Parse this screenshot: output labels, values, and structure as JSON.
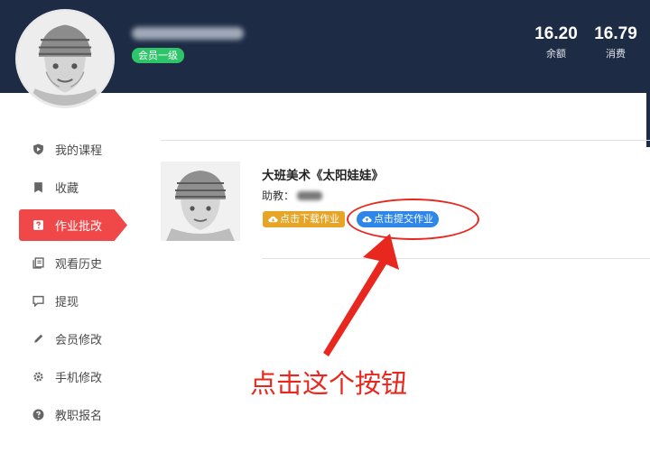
{
  "header": {
    "username": "",
    "member_badge": "会员一级",
    "stats": {
      "balance": {
        "value": "16.20",
        "label": "余额"
      },
      "spend": {
        "value": "16.79",
        "label": "消费"
      }
    }
  },
  "sidebar": {
    "items": [
      {
        "label": "我的课程",
        "icon": "shield-icon",
        "active": false
      },
      {
        "label": "收藏",
        "icon": "bookmark-icon",
        "active": false
      },
      {
        "label": "作业批改",
        "icon": "question-icon",
        "active": true
      },
      {
        "label": "观看历史",
        "icon": "history-icon",
        "active": false
      },
      {
        "label": "提现",
        "icon": "chat-icon",
        "active": false
      },
      {
        "label": "会员修改",
        "icon": "pencil-icon",
        "active": false
      },
      {
        "label": "手机修改",
        "icon": "gear-icon",
        "active": false
      },
      {
        "label": "教职报名",
        "icon": "help-icon",
        "active": false
      }
    ]
  },
  "course": {
    "title": "大班美术《太阳娃娃》",
    "assistant_label": "助教：",
    "download_button": "点击下载作业",
    "submit_button": "点击提交作业"
  },
  "annotation": {
    "text": "点击这个按钮",
    "color": "#e8281e"
  },
  "colors": {
    "header_bg": "#1e2b45",
    "accent_red": "#f04848",
    "badge_green": "#2ec56a",
    "download_orange": "#e7a528",
    "submit_blue": "#2d86e8"
  }
}
